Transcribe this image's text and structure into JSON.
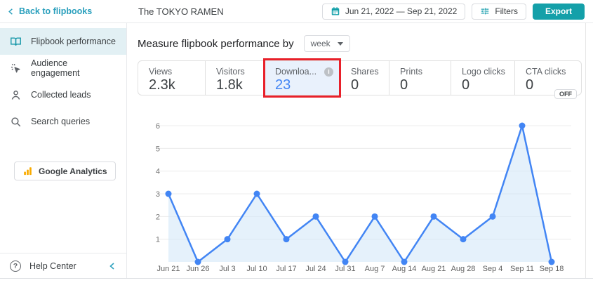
{
  "header": {
    "back_label": "Back to flipbooks",
    "title": "The TOKYO RAMEN",
    "date_range": "Jun 21, 2022 — Sep 21, 2022",
    "filters_label": "Filters",
    "export_label": "Export"
  },
  "sidebar": {
    "items": [
      {
        "label": "Flipbook performance",
        "icon": "book-icon",
        "active": true
      },
      {
        "label": "Audience engagement",
        "icon": "cursor-click-icon",
        "active": false
      },
      {
        "label": "Collected leads",
        "icon": "person-icon",
        "active": false
      },
      {
        "label": "Search queries",
        "icon": "search-icon",
        "active": false
      }
    ],
    "google_analytics_label": "Google Analytics",
    "help_center_label": "Help Center"
  },
  "main": {
    "measure_label": "Measure flipbook performance by",
    "period_value": "week",
    "stats": [
      {
        "label": "Views",
        "value": "2.3k"
      },
      {
        "label": "Visitors",
        "value": "1.8k"
      },
      {
        "label": "Downloa...",
        "value": "23",
        "selected": true,
        "has_info_icon": true,
        "annotated": true
      },
      {
        "label": "Shares",
        "value": "0"
      },
      {
        "label": "Prints",
        "value": "0"
      },
      {
        "label": "Logo clicks",
        "value": "0"
      },
      {
        "label": "CTA clicks",
        "value": "0",
        "badge": "OFF"
      }
    ]
  },
  "icons": {
    "info_glyph": "i",
    "help_glyph": "?"
  },
  "colors": {
    "brand_teal": "#14a0a9",
    "link_teal": "#2ba0bd",
    "accent_blue": "#4285f4",
    "annotation_red": "#e8202a",
    "selected_card_bg": "#e9f1fc",
    "active_nav_bg": "#e2f0f4",
    "ga_orange": "#f9ab00"
  },
  "chart_data": {
    "type": "line",
    "x": [
      "Jun 21",
      "Jun 26",
      "Jul 3",
      "Jul 10",
      "Jul 17",
      "Jul 24",
      "Jul 31",
      "Aug 7",
      "Aug 14",
      "Aug 21",
      "Aug 28",
      "Sep 4",
      "Sep 11",
      "Sep 18"
    ],
    "series": [
      {
        "name": "Downloads",
        "values": [
          3,
          0,
          1,
          3,
          1,
          2,
          0,
          2,
          0,
          2,
          1,
          2,
          6,
          0
        ]
      }
    ],
    "ylim": [
      0,
      6
    ],
    "yticks": [
      1,
      2,
      3,
      4,
      5,
      6
    ],
    "grid": true,
    "legend": false,
    "line_color": "#4285f4",
    "point_color": "#4285f4",
    "fill_color": "#cfe6f8"
  }
}
